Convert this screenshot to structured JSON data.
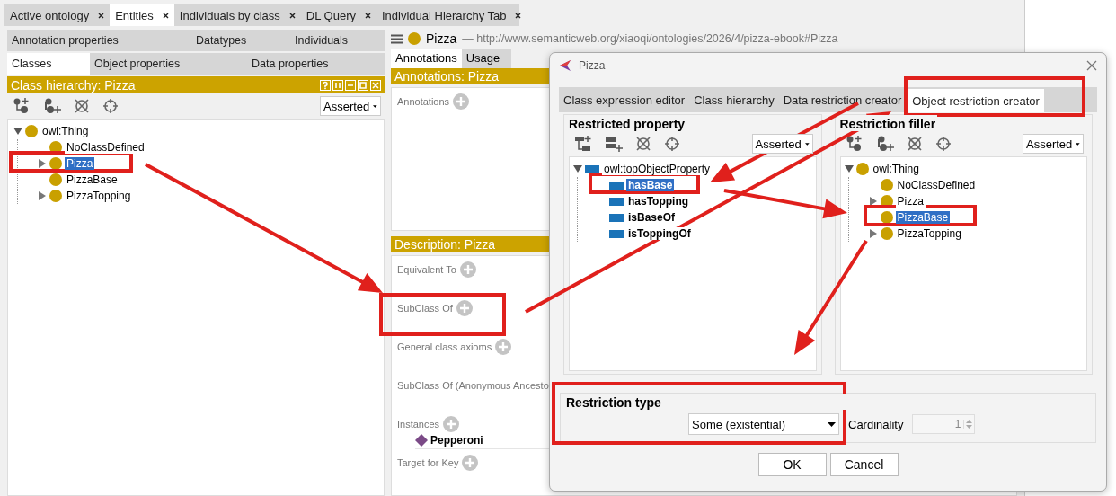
{
  "main_tabs": [
    {
      "label": "Active ontology",
      "selected": false
    },
    {
      "label": "Entities",
      "selected": true
    },
    {
      "label": "Individuals by class",
      "selected": false
    },
    {
      "label": "DL Query",
      "selected": false
    },
    {
      "label": "Individual Hierarchy Tab",
      "selected": false
    }
  ],
  "entity_tabs_top": [
    {
      "label": "Annotation properties",
      "selected": false
    },
    {
      "label": "Datatypes",
      "selected": false
    },
    {
      "label": "Individuals",
      "selected": false
    }
  ],
  "entity_tabs_bottom": [
    {
      "label": "Classes",
      "selected": true
    },
    {
      "label": "Object properties",
      "selected": false
    },
    {
      "label": "Data properties",
      "selected": false
    }
  ],
  "class_hierarchy": {
    "title": "Class hierarchy: Pizza",
    "mode": "Asserted",
    "kind": "class",
    "tree": [
      {
        "label": "owl:Thing",
        "selected": false,
        "expanded": true,
        "children": [
          {
            "label": "NoClassDefined",
            "selected": false,
            "expanded": false
          },
          {
            "label": "Pizza",
            "selected": true,
            "expanded": false,
            "expandable": true
          },
          {
            "label": "PizzaBase",
            "selected": false,
            "expanded": false
          },
          {
            "label": "PizzaTopping",
            "selected": false,
            "expanded": false,
            "expandable": true
          }
        ]
      }
    ]
  },
  "entity_header": {
    "name": "Pizza",
    "iri": "— http://www.semanticweb.org/xiaoqi/ontologies/2026/4/pizza-ebook#Pizza"
  },
  "view_tabs": [
    {
      "label": "Annotations",
      "selected": true
    },
    {
      "label": "Usage",
      "selected": false
    }
  ],
  "annotations_title": "Annotations: Pizza",
  "annotations_label": "Annotations",
  "description": {
    "title": "Description: Pizza",
    "sections": [
      {
        "label": "Equivalent To",
        "addable": true
      },
      {
        "label": "SubClass Of",
        "addable": true
      },
      {
        "label": "General class axioms",
        "addable": true
      },
      {
        "label": "SubClass Of (Anonymous Ancesto",
        "addable": false
      },
      {
        "label": "Instances",
        "addable": true,
        "items": [
          "Pepperoni"
        ]
      },
      {
        "label": "Target for Key",
        "addable": true
      }
    ]
  },
  "dialog": {
    "title": "Pizza",
    "tabs": [
      {
        "label": "Class expression editor",
        "selected": false
      },
      {
        "label": "Class hierarchy",
        "selected": false
      },
      {
        "label": "Data restriction creator",
        "selected": false
      },
      {
        "label": "Object restriction creator",
        "selected": true
      }
    ],
    "property_panel": {
      "title": "Restricted property",
      "mode": "Asserted",
      "kind": "property",
      "tree": [
        {
          "label": "owl:topObjectProperty",
          "selected": false,
          "expanded": true,
          "children": [
            {
              "label": "hasBase",
              "selected": true,
              "expanded": false
            },
            {
              "label": "hasTopping",
              "selected": false,
              "expanded": false
            },
            {
              "label": "isBaseOf",
              "selected": false,
              "expanded": false
            },
            {
              "label": "isToppingOf",
              "selected": false,
              "expanded": false
            }
          ]
        }
      ]
    },
    "filler_panel": {
      "title": "Restriction filler",
      "mode": "Asserted",
      "kind": "class",
      "tree": [
        {
          "label": "owl:Thing",
          "selected": false,
          "expanded": true,
          "children": [
            {
              "label": "NoClassDefined",
              "selected": false,
              "expanded": false
            },
            {
              "label": "Pizza",
              "selected": false,
              "expanded": false,
              "expandable": true
            },
            {
              "label": "PizzaBase",
              "selected": true,
              "expanded": false
            },
            {
              "label": "PizzaTopping",
              "selected": false,
              "expanded": false,
              "expandable": true
            }
          ]
        }
      ]
    },
    "restriction_type": {
      "title": "Restriction type",
      "value": "Some (existential)"
    },
    "cardinality": {
      "label": "Cardinality",
      "value": "1",
      "disabled": true
    },
    "buttons": [
      "OK",
      "Cancel"
    ]
  }
}
